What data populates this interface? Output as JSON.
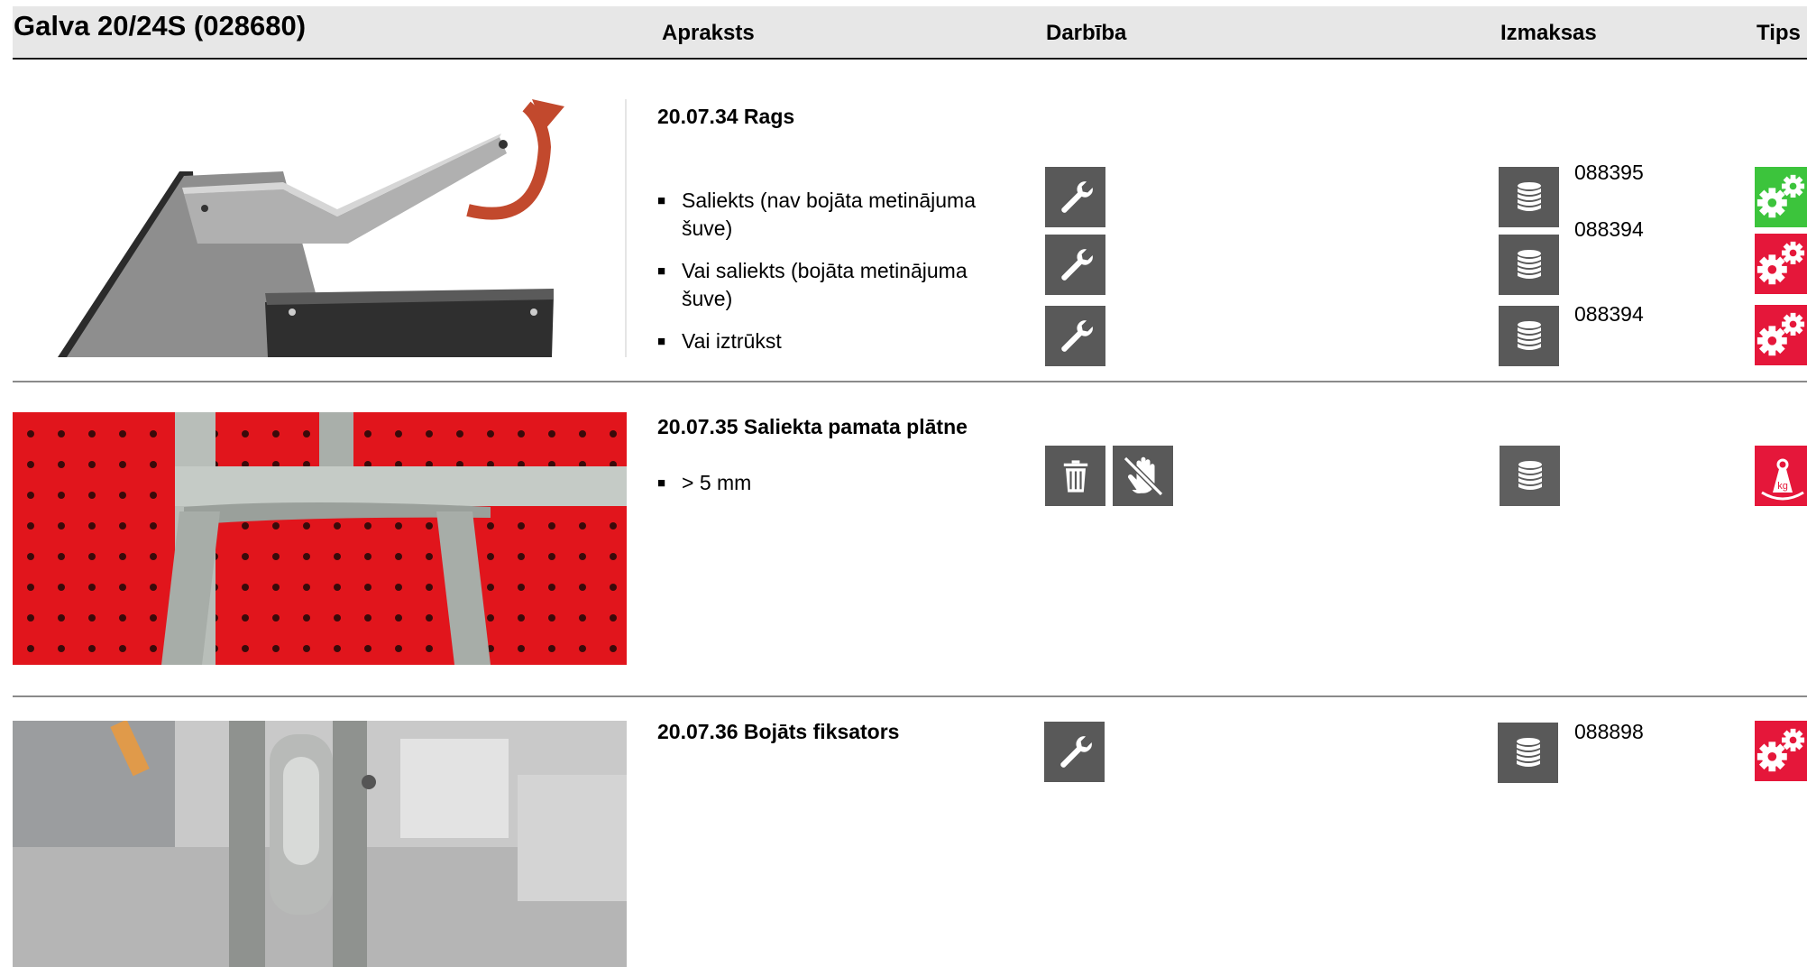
{
  "header": {
    "title": "Galva 20/24S (028680)",
    "col_description": "Apraksts",
    "col_action": "Darbība",
    "col_costs": "Izmaksas",
    "col_type": "Tips"
  },
  "sections": [
    {
      "title": "20.07.34 Rags",
      "items": [
        {
          "text": "Saliekts (nav bojāta metinājuma šuve)",
          "action_icon": "wrench-icon",
          "cost_icon": "coins-icon",
          "code": "088395",
          "type_icon": "gears-icon",
          "type_color": "#3cc43c"
        },
        {
          "text": "Vai saliekts (bojāta metinājuma šuve)",
          "action_icon": "wrench-icon",
          "cost_icon": "coins-icon",
          "code": "088394",
          "type_icon": "gears-icon",
          "type_color": "#e5173a"
        },
        {
          "text": "Vai iztrūkst",
          "action_icon": "wrench-icon",
          "cost_icon": "coins-icon",
          "code": "088394",
          "type_icon": "gears-icon",
          "type_color": "#e5173a"
        }
      ]
    },
    {
      "title": "20.07.35 Saliekta pamata plātne",
      "items": [
        {
          "text": "> 5 mm",
          "action_icons": [
            "trash-icon",
            "no-touch-icon"
          ],
          "cost_icon": "coins-icon",
          "code": "",
          "type_icon": "weight-kg-icon",
          "type_color": "#e5173a"
        }
      ]
    },
    {
      "title": "20.07.36 Bojāts fiksators",
      "items": [
        {
          "action_icon": "wrench-icon",
          "cost_icon": "coins-icon",
          "code": "088898",
          "type_icon": "gears-icon",
          "type_color": "#e5173a"
        }
      ]
    }
  ],
  "bullet_glyph": "■",
  "weight_label": "kg"
}
